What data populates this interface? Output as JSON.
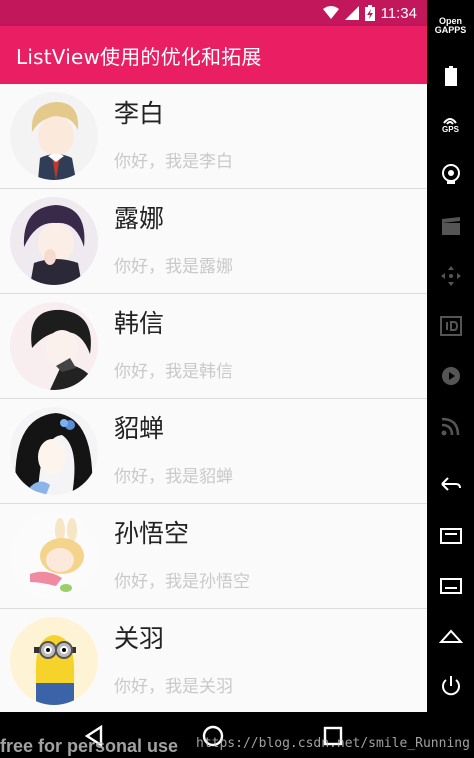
{
  "status_bar": {
    "time": "11:34"
  },
  "app_bar": {
    "title": "ListView使用的优化和拓展"
  },
  "list": [
    {
      "name": "李白",
      "greeting": "你好，我是李白"
    },
    {
      "name": "露娜",
      "greeting": "你好，我是露娜"
    },
    {
      "name": "韩信",
      "greeting": "你好，我是韩信"
    },
    {
      "name": "貂蝉",
      "greeting": "你好，我是貂蝉"
    },
    {
      "name": "孙悟空",
      "greeting": "你好，我是孙悟空"
    },
    {
      "name": "关羽",
      "greeting": "你好，我是关羽"
    }
  ],
  "emulator_panel": {
    "opengapps_line1": "Open",
    "opengapps_line2": "GAPPS",
    "gps_label": "GPS"
  },
  "watermark": {
    "left": "free for personal use",
    "right": "https://blog.csdn.net/smile_Running"
  },
  "colors": {
    "status_bar": "#c2185b",
    "app_bar": "#e91e63",
    "list_bg": "#fafafa",
    "greeting": "#c9c9c9"
  }
}
